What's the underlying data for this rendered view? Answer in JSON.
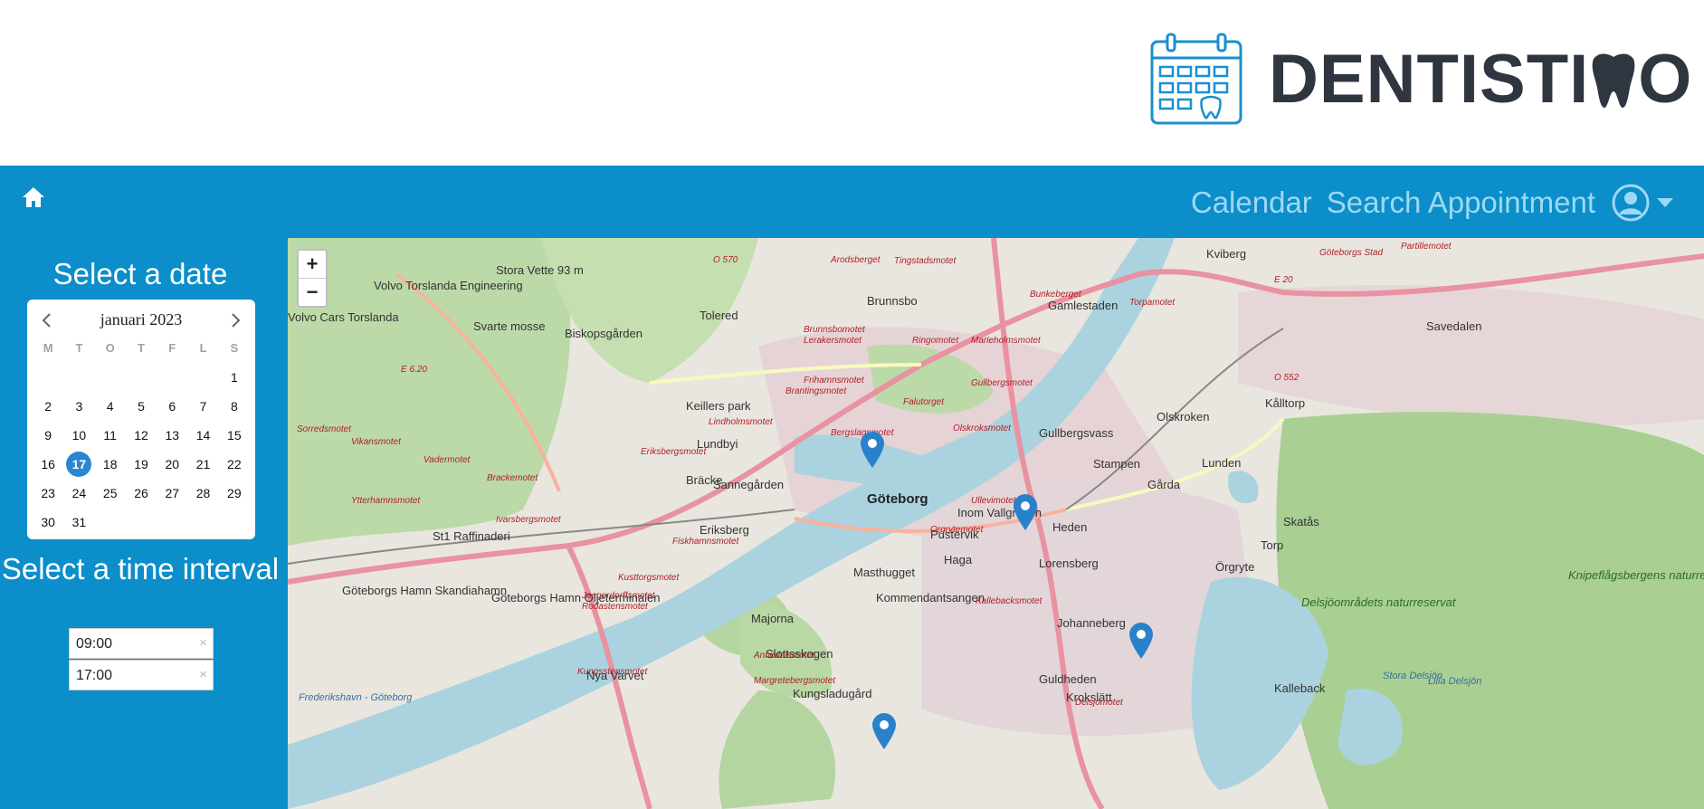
{
  "brand": {
    "name_part1": "DENTISTI",
    "name_part2": "O"
  },
  "nav": {
    "calendar": "Calendar",
    "search_appointment": "Search Appointment"
  },
  "sidebar": {
    "date_title": "Select a date",
    "time_title": "Select a time interval",
    "calendar": {
      "month_label": "januari 2023",
      "weekdays": [
        "M",
        "T",
        "O",
        "T",
        "F",
        "L",
        "S"
      ],
      "selected_day": "17",
      "weeks": [
        [
          "",
          "",
          "",
          "",
          "",
          "",
          "1"
        ],
        [
          "2",
          "3",
          "4",
          "5",
          "6",
          "7",
          "8"
        ],
        [
          "9",
          "10",
          "11",
          "12",
          "13",
          "14",
          "15"
        ],
        [
          "16",
          "17",
          "18",
          "19",
          "20",
          "21",
          "22"
        ],
        [
          "23",
          "24",
          "25",
          "26",
          "27",
          "28",
          "29"
        ],
        [
          "30",
          "31",
          "",
          "",
          "",
          "",
          ""
        ]
      ]
    },
    "time_from": "09:00",
    "time_to": "17:00",
    "clear_symbol": "×"
  },
  "map": {
    "zoom_in": "+",
    "zoom_out": "−",
    "places": [
      "Göteborg",
      "Gamlestaden",
      "Kviberg",
      "Brunnsbo",
      "Tolered",
      "Biskopsgården",
      "Kålltorp",
      "Savedalen",
      "Gullbergsvass",
      "Stampen",
      "Gårda",
      "Lunden",
      "Olskroken",
      "Bräcke",
      "Sannegården",
      "Eriksberg",
      "Inom Vallgraven",
      "Heden",
      "Pustervik",
      "Haga",
      "Lorensberg",
      "Örgryte",
      "Torp",
      "Skatås",
      "Masthugget",
      "Kommendantsangen",
      "Majorna",
      "Johanneberg",
      "Nya Varvet",
      "Kungsladugård",
      "Guldheden",
      "Krokslätt",
      "Kalleback",
      "Svarte mosse",
      "Volvo Torslanda Engineering",
      "Göteborgs Hamn Skandiahamn",
      "Göteborgs Hamn Oljeterminalen",
      "St1 Raffinaderi",
      "Delsjöområdets naturreservat",
      "Knipeflågsbergens naturreservat",
      "Stora Delsjön",
      "Lilla Delsjön",
      "Stora Vette 93 m",
      "Volvo Cars Torslanda",
      "Keillers park",
      "Lundbyi",
      "Slottsskogen",
      "Frederikshavn - Göteborg"
    ],
    "roads": [
      "Tingstadsmotet",
      "Brunnsbomotet",
      "Lerakersmotet",
      "Frihamnsmotet",
      "Brantingsmotet",
      "Lindholmsmotet",
      "Eriksbergsmotet",
      "Brackemotet",
      "Ivarsbergsmotet",
      "Vikansmotet",
      "Vadermotet",
      "Sorredsmotet",
      "Ytterhamnsmotet",
      "Fiskhamnsmotet",
      "Kusttorgsmotet",
      "Jaegerdorffsmotet",
      "Rodastensmotet",
      "Kungsstensmotet",
      "Annedalsmotet",
      "Margretebergsmotet",
      "Kallebacksmotet",
      "Ullevimotet",
      "Olskroksmotet",
      "Gullbergsmotet",
      "Marieholmsmotet",
      "Ringomotet",
      "Torpamotet",
      "Bergslagsmotet",
      "Falutorget",
      "Delsjomotet",
      "Orgrytemotet",
      "Partillemotet",
      "E 6.20",
      "E 20",
      "O 570",
      "O 552",
      "Göteborgs Stad",
      "Bunkeberget",
      "Arodsberget"
    ]
  }
}
